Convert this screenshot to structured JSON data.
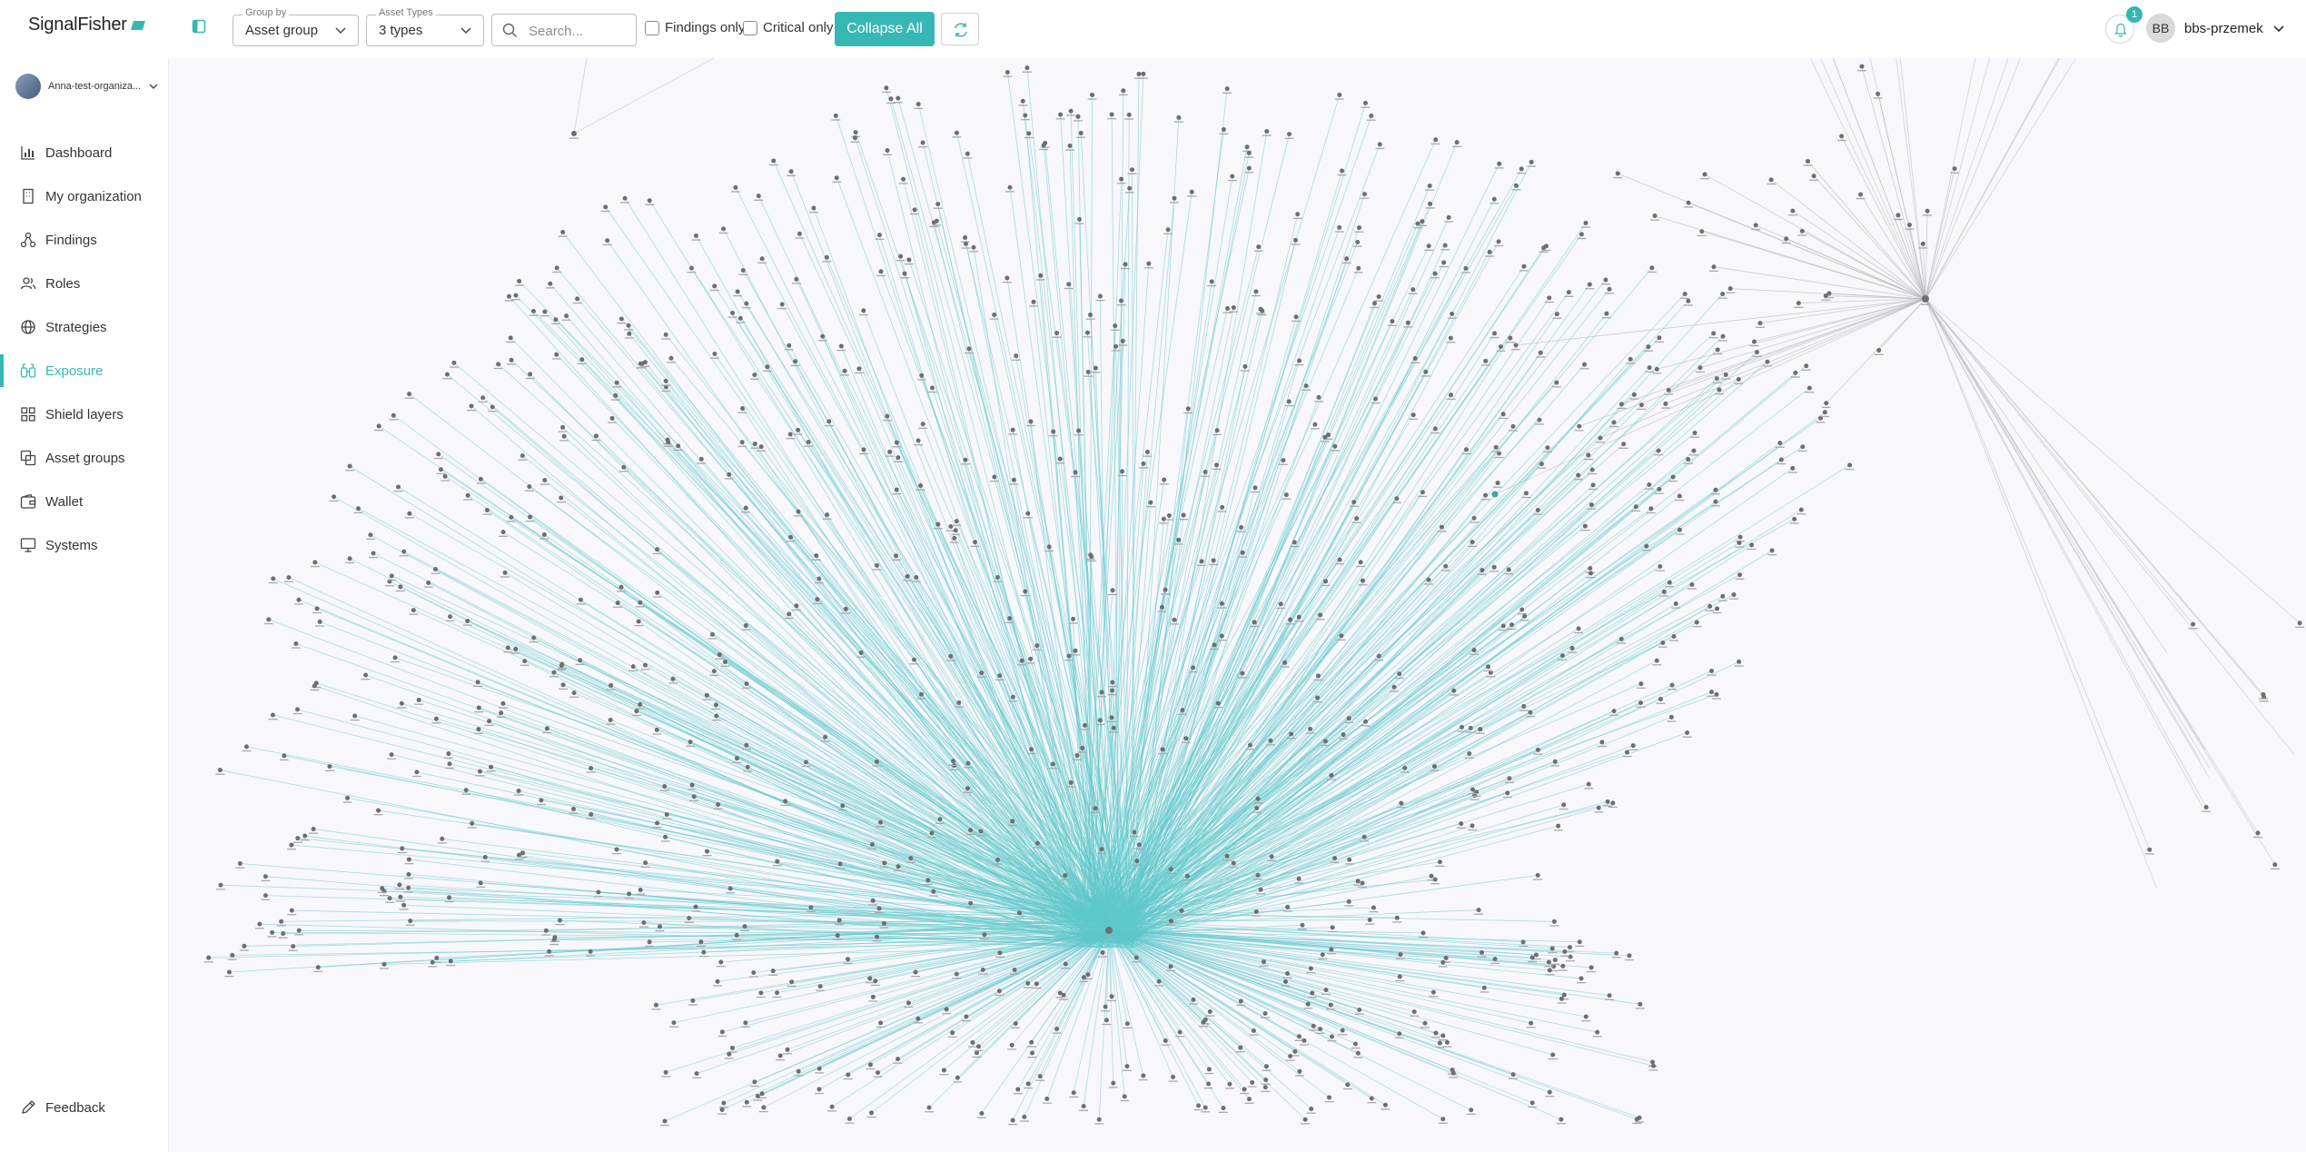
{
  "app": {
    "brand": "SignalFisher"
  },
  "toolbar": {
    "group_by": {
      "label": "Group by",
      "value": "Asset group"
    },
    "asset_types": {
      "label": "Asset Types",
      "value": "3 types"
    },
    "search": {
      "placeholder": "Search..."
    },
    "findings_only": {
      "label": "Findings only",
      "checked": false
    },
    "critical_only": {
      "label": "Critical only",
      "checked": false
    },
    "collapse_all_label": "Collapse All"
  },
  "header": {
    "notifications_count": "1",
    "user": {
      "initials": "BB",
      "name": "bbs-przemek"
    }
  },
  "sidebar": {
    "org_name": "Anna-test-organiza...",
    "items": [
      {
        "label": "Dashboard",
        "icon": "chart-icon"
      },
      {
        "label": "My organization",
        "icon": "building-icon"
      },
      {
        "label": "Findings",
        "icon": "findings-icon"
      },
      {
        "label": "Roles",
        "icon": "users-icon"
      },
      {
        "label": "Strategies",
        "icon": "globe-icon"
      },
      {
        "label": "Exposure",
        "icon": "binoculars-icon",
        "active": true
      },
      {
        "label": "Shield layers",
        "icon": "grid-icon"
      },
      {
        "label": "Asset groups",
        "icon": "layers-icon"
      },
      {
        "label": "Wallet",
        "icon": "wallet-icon"
      },
      {
        "label": "Systems",
        "icon": "monitor-icon"
      }
    ],
    "feedback_label": "Feedback"
  },
  "colors": {
    "accent": "#36b7b4",
    "graph_background": "#f8f7fb",
    "edge_teal": "#5ec8cb",
    "edge_gray": "#b9b9bf",
    "node": "#6e6e72"
  }
}
